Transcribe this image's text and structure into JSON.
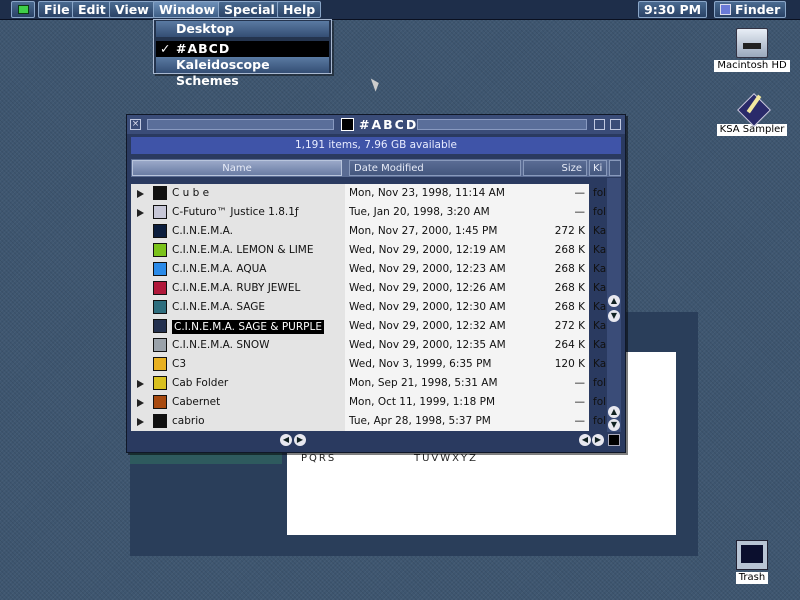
{
  "menubar": {
    "items": [
      "File",
      "Edit",
      "View",
      "Window",
      "Special",
      "Help"
    ],
    "clock": "9:30 PM",
    "app_name": "Finder"
  },
  "window_menu": {
    "items": [
      "Desktop",
      "#ABCD",
      "Kaleidoscope Schemes"
    ],
    "checked": "#ABCD",
    "checkmark": "✓"
  },
  "desktop_icons": {
    "hd": "Macintosh HD",
    "ksa": "KSA Sampler",
    "trash": "Trash"
  },
  "background_doc": {
    "text1": "PQRS",
    "text2": "TUVWXYZ"
  },
  "finder_window": {
    "title": "#ABCD",
    "info": "1,191 items, 7.96 GB available",
    "columns": {
      "name": "Name",
      "date": "Date Modified",
      "size": "Size",
      "kind": "Ki"
    },
    "rows": [
      {
        "name": "C u b e",
        "date": "Mon, Nov 23, 1998, 11:14 AM",
        "size": "—",
        "kind": "fol",
        "folder": true,
        "icon_color": "#111111"
      },
      {
        "name": "C-Futuro™ Justice 1.8.1ƒ",
        "date": "Tue, Jan 20, 1998, 3:20 AM",
        "size": "—",
        "kind": "fol",
        "folder": true,
        "icon_color": "#c8c8d8"
      },
      {
        "name": "C.I.N.E.M.A.",
        "date": "Mon, Nov 27, 2000, 1:45 PM",
        "size": "272 K",
        "kind": "Ka",
        "folder": false,
        "icon_color": "#0c1e3e"
      },
      {
        "name": "C.I.N.E.M.A.  LEMON & LIME",
        "date": "Wed, Nov 29, 2000, 12:19 AM",
        "size": "268 K",
        "kind": "Ka",
        "folder": false,
        "icon_color": "#7ac21a"
      },
      {
        "name": "C.I.N.E.M.A. AQUA",
        "date": "Wed, Nov 29, 2000, 12:23 AM",
        "size": "268 K",
        "kind": "Ka",
        "folder": false,
        "icon_color": "#2a8ae8"
      },
      {
        "name": "C.I.N.E.M.A. RUBY JEWEL",
        "date": "Wed, Nov 29, 2000, 12:26 AM",
        "size": "268 K",
        "kind": "Ka",
        "folder": false,
        "icon_color": "#b0183a"
      },
      {
        "name": "C.I.N.E.M.A. SAGE",
        "date": "Wed, Nov 29, 2000, 12:30 AM",
        "size": "268 K",
        "kind": "Ka",
        "folder": false,
        "icon_color": "#2e6e7e"
      },
      {
        "name": "C.I.N.E.M.A. SAGE & PURPLE",
        "date": "Wed, Nov 29, 2000, 12:32 AM",
        "size": "272 K",
        "kind": "Ka",
        "folder": false,
        "icon_color": "#23304e",
        "selected": true
      },
      {
        "name": "C.I.N.E.M.A. SNOW",
        "date": "Wed, Nov 29, 2000, 12:35 AM",
        "size": "264 K",
        "kind": "Ka",
        "folder": false,
        "icon_color": "#9aa2aa"
      },
      {
        "name": "C3",
        "date": "Wed, Nov 3, 1999, 6:35 PM",
        "size": "120 K",
        "kind": "Ka",
        "folder": false,
        "icon_color": "#e8b020"
      },
      {
        "name": "Cab Folder",
        "date": "Mon, Sep 21, 1998, 5:31 AM",
        "size": "—",
        "kind": "fol",
        "folder": true,
        "icon_color": "#d8c020"
      },
      {
        "name": "Cabernet",
        "date": "Mon, Oct 11, 1999, 1:18 PM",
        "size": "—",
        "kind": "fol",
        "folder": true,
        "icon_color": "#a84a10"
      },
      {
        "name": "cabrio",
        "date": "Tue, Apr 28, 1998, 5:37 PM",
        "size": "—",
        "kind": "fol",
        "folder": true,
        "icon_color": "#101010"
      }
    ]
  },
  "colors": {
    "menubar_bg": "#1e2e4a",
    "selection": "#000000",
    "info_bar": "#3f54a8"
  },
  "icons": [
    "apple-menu-icon",
    "finder-icon",
    "close-box-icon",
    "zoom-box-icon",
    "collapse-box-icon",
    "disclosure-triangle-icon",
    "scroll-arrow-icon",
    "grow-box-icon",
    "hard-disk-icon",
    "trash-icon"
  ]
}
